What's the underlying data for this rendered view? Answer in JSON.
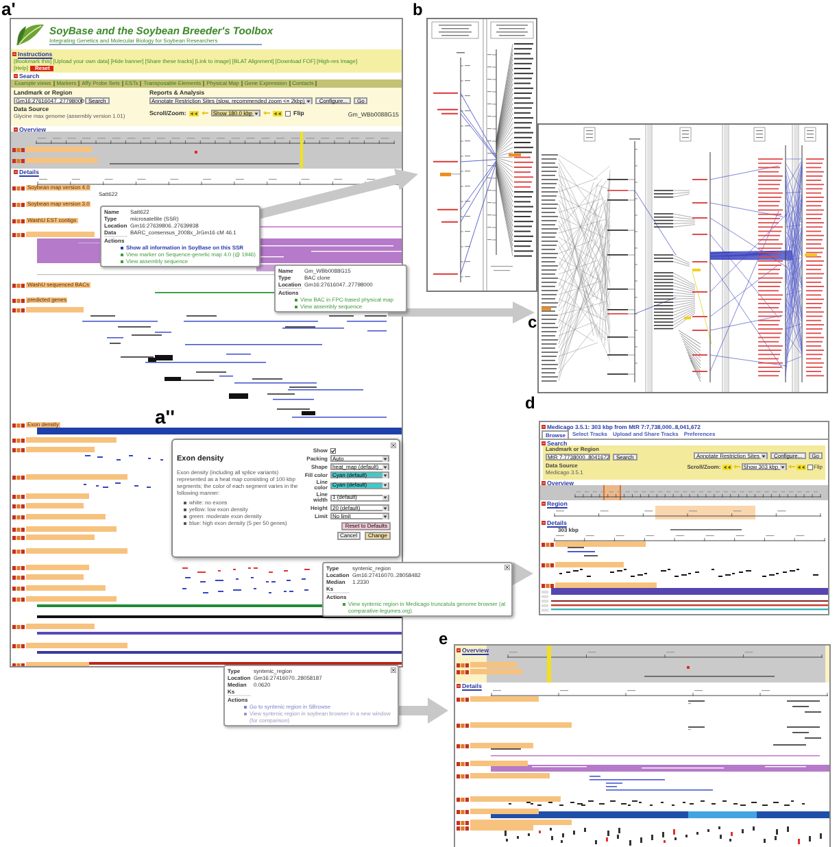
{
  "soybase_browser": {
    "panel_label": "a'",
    "banner": {
      "title": "SoyBase and the Soybean Breeder's Toolbox",
      "subtitle": "Integrating Genetics and Molecular Biology for Soybean Researchers"
    },
    "instructions": {
      "heading": "Instructions",
      "links": [
        "[Bookmark this]",
        "[Upload your own data]",
        "[Hide banner]",
        "[Share these tracks]",
        "[Link to image]",
        "[BLAT Alignment]",
        "[Download FOF]",
        "[High-res Image]"
      ],
      "help": "[Help]",
      "reset": "Reset"
    },
    "search_heading": "Search",
    "menu": [
      "Example views",
      "Markers",
      "Affy Probe Sets",
      "ESTs",
      "Transposable Elements",
      "Physical Map",
      "Gene Expression",
      "Contacts"
    ],
    "form": {
      "landmark_label": "Landmark or Region",
      "landmark_value": "Gm16:27616047..27798000",
      "search_button": "Search",
      "data_source_label": "Data Source",
      "data_source": "Glycine max genome (assembly version 1.01)",
      "reports_label": "Reports & Analysis",
      "reports_value": "Annotate Restriction Sites (slow, recommended zoom <= 2kbp)",
      "configure_button": "Configure...",
      "go_button": "Go",
      "scroll_zoom_label": "Scroll/Zoom:",
      "zoom_value": "Show 180.0 kbp",
      "flip_label": "Flip",
      "flip_checked": false,
      "landmark_name": "Gm_WBb0088G15"
    },
    "overview": {
      "heading": "Overview"
    },
    "details": {
      "heading": "Details",
      "tracks": [
        {
          "kind": "marker",
          "label": "Soybean map version 4.0",
          "features": [
            "Satt622"
          ]
        },
        {
          "kind": "marker",
          "label": "Soybean map version 3.0"
        },
        {
          "kind": "est",
          "label": "WashU EST contigs"
        },
        {
          "kind": "bac_band"
        },
        {
          "kind": "bac_line",
          "label": "WashU sequenced BACs"
        },
        {
          "kind": "empty",
          "label": "predicted genes"
        },
        {
          "kind": "gene_models"
        },
        {
          "kind": "heatmap",
          "label": "Exon density"
        },
        {
          "kind": "empty"
        },
        {
          "kind": "marks",
          "color": "#3344c0"
        },
        {
          "kind": "marks",
          "color": "#3344c0"
        },
        {
          "kind": "empty"
        },
        {
          "kind": "empty"
        },
        {
          "kind": "empty"
        },
        {
          "kind": "empty"
        },
        {
          "kind": "empty"
        },
        {
          "kind": "empty"
        },
        {
          "kind": "marks",
          "color": "#e03030"
        },
        {
          "kind": "marks",
          "color": "#3344c0"
        },
        {
          "kind": "marks",
          "color": "#3344c0"
        },
        {
          "kind": "synteny",
          "lines": [
            {
              "color": "#1f8a34"
            },
            {
              "color": "#111111"
            }
          ]
        },
        {
          "kind": "synteny",
          "lines": [
            {
              "color": "#5a48b8"
            }
          ]
        },
        {
          "kind": "synteny",
          "lines": [
            {
              "color": "#3a3aa0"
            },
            {
              "color": "#b8281e"
            }
          ]
        },
        {
          "kind": "empty"
        }
      ]
    },
    "popups": [
      {
        "closable": false,
        "fields": [
          {
            "label": "Name",
            "value": "Satt622"
          },
          {
            "label": "Type",
            "value": "microsatellite (SSR)"
          },
          {
            "label": "Location",
            "value": "Gm16:27639806..27639938"
          },
          {
            "label": "Data",
            "value": "BARC_consensus_2008x_JrGm16 cM 46.1"
          }
        ],
        "actions_label": "Actions",
        "actions": [
          {
            "kind": "primary",
            "text": "Show all information in SoyBase on this SSR",
            "color": "#2b3ca8"
          },
          {
            "kind": "secondary",
            "text": "View marker on Sequence-genetic map 4.0 (@ 1946)",
            "color": "#3d9a3a"
          },
          {
            "kind": "secondary",
            "text": "View assembly sequence",
            "color": "#3d9a3a"
          }
        ]
      },
      {
        "closable": false,
        "fields": [
          {
            "label": "Name",
            "value": "Gm_WBb0088G15"
          },
          {
            "label": "Type",
            "value": "BAC clone"
          },
          {
            "label": "Location",
            "value": "Gm16:27616047..27798000"
          }
        ],
        "actions_label": "Actions",
        "actions": [
          {
            "kind": "secondary",
            "text": "View BAC in FPC-based physical map",
            "color": "#3d9a3a"
          },
          {
            "kind": "secondary",
            "text": "View assembly sequence",
            "color": "#3d9a3a"
          }
        ]
      },
      {
        "closable": true,
        "fields": [
          {
            "label": "Type",
            "value": "syntenic_region"
          },
          {
            "label": "Location",
            "value": "Gm16:27416070..28058482"
          },
          {
            "label": "Median Ks",
            "value": "1.2330"
          }
        ],
        "actions_label": "Actions",
        "actions": [
          {
            "kind": "secondary",
            "text": "View syntenic region in Medicago truncatula genome browser (at comparative-legumes.org)",
            "color": "#3d9a3a"
          }
        ]
      },
      {
        "closable": true,
        "fields": [
          {
            "label": "Type",
            "value": "syntenic_region"
          },
          {
            "label": "Location",
            "value": "Gm16:27416070..28058187"
          },
          {
            "label": "Median Ks",
            "value": "0.0620"
          }
        ],
        "actions_label": "Actions",
        "actions": [
          {
            "kind": "secondary",
            "text": "Go to syntenic region in SBrowse",
            "color": "#7a80c8"
          },
          {
            "kind": "secondary",
            "text": "View syntenic region in soybean browser in a new window (for comparison)",
            "color": "#9a9ac0"
          }
        ]
      }
    ]
  },
  "exon_density_dialog": {
    "panel_label": "a''",
    "title": "Exon density",
    "description": "Exon density (including all splice variants) represented as a heat map consisting of 100 kbp segments; the color of each segment varies in the following manner:",
    "legend": [
      "white: no exons",
      "yellow: low exon density",
      "green: moderate exon density",
      "blue: high exon density (5 per 50 genes)"
    ],
    "settings": [
      {
        "kind": "checkbox",
        "label": "Show",
        "checked": true
      },
      {
        "kind": "select",
        "label": "Packing",
        "value": "Auto"
      },
      {
        "kind": "select",
        "label": "Shape",
        "value": "heat_map (default)"
      },
      {
        "kind": "color",
        "label": "Fill color",
        "value": "Cyan (default)"
      },
      {
        "kind": "color",
        "label": "Line color",
        "value": "Cyan (default)"
      },
      {
        "kind": "select",
        "label": "Line width",
        "value": "1 (default)"
      },
      {
        "kind": "select",
        "label": "Height",
        "value": "20 (default)"
      },
      {
        "kind": "select",
        "label": "Limit",
        "value": "No limit"
      }
    ],
    "buttons": [
      {
        "kind": "reset",
        "label": "Reset to Defaults"
      },
      {
        "kind": "cancel",
        "label": "Cancel"
      },
      {
        "kind": "submit",
        "label": "Change"
      }
    ]
  },
  "comparative_map_b": {
    "panel_label": "b"
  },
  "comparative_map_c": {
    "panel_label": "c"
  },
  "medicago_browser": {
    "panel_label": "d",
    "title": "Medicago 3.5.1: 303 kbp from MtR 7:7,738,000..8,041,672",
    "tabs": [
      {
        "label": "Browse",
        "selected": true
      },
      {
        "label": "Select Tracks",
        "selected": false
      },
      {
        "label": "Upload and Share Tracks",
        "selected": false
      },
      {
        "label": "Preferences",
        "selected": false
      }
    ],
    "search_heading": "Search",
    "landmark_label": "Landmark or Region",
    "landmark_value": "MtR 7:7738000..8041672",
    "search_button": "Search",
    "data_source_label": "Data Source",
    "data_source": "Medicago 3.5.1",
    "reports_value": "Annotate Restriction Sites",
    "configure_button": "Configure...",
    "go_button": "Go",
    "scroll_zoom_label": "Scroll/Zoom:",
    "zoom_value": "Show 303 kbp",
    "flip_label": "Flip",
    "flip_checked": false,
    "overview_heading": "Overview",
    "region_heading": "Region",
    "details_heading": "Details",
    "span_label": "303 kbp",
    "tracks": [
      {
        "kind": "text_features"
      },
      {
        "kind": "marks"
      },
      {
        "kind": "synteny_band"
      }
    ]
  },
  "soybase_zoomed_view": {
    "panel_label": "e",
    "overview_heading": "Overview",
    "details_heading": "Details",
    "tracks": [
      {
        "kind": "text_features"
      },
      {
        "kind": "text_features"
      },
      {
        "kind": "line"
      },
      {
        "kind": "band"
      },
      {
        "kind": "gene_text"
      },
      {
        "kind": "marks"
      },
      {
        "kind": "density"
      },
      {
        "kind": "empty"
      },
      {
        "kind": "marks_red"
      },
      {
        "kind": "empty"
      }
    ]
  }
}
